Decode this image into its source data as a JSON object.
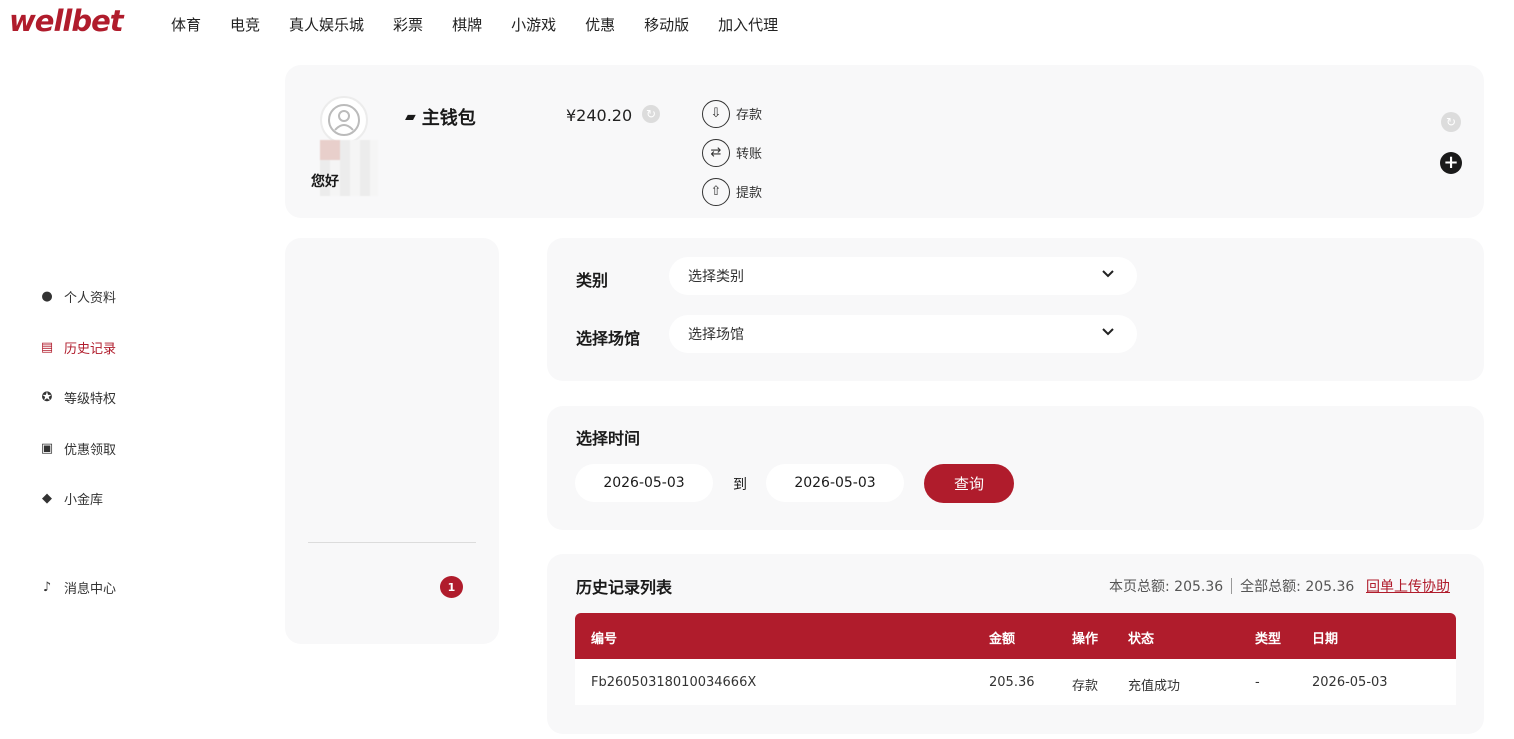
{
  "brand": {
    "logo_text": "wellbet",
    "color": "#b01c2c"
  },
  "nav": [
    "体育",
    "电竞",
    "真人娱乐城",
    "彩票",
    "棋牌",
    "小游戏",
    "优惠",
    "移动版",
    "加入代理"
  ],
  "profile": {
    "nickname": "您好",
    "wallet_title": "主钱包",
    "balance": "¥240.20",
    "actions": [
      {
        "label": "存款",
        "icon": "deposit-icon"
      },
      {
        "label": "转账",
        "icon": "transfer-icon"
      },
      {
        "label": "提款",
        "icon": "withdraw-icon"
      }
    ]
  },
  "sidebar": {
    "items": [
      {
        "label": "个人资料",
        "icon": "user-icon"
      },
      {
        "label": "历史记录",
        "icon": "history-icon",
        "active": true
      },
      {
        "label": "等级特权",
        "icon": "medal-icon"
      },
      {
        "label": "优惠领取",
        "icon": "gift-icon"
      },
      {
        "label": "小金库",
        "icon": "diamond-icon"
      }
    ],
    "messages": {
      "label": "消息中心",
      "icon": "bell-icon",
      "count": "1"
    }
  },
  "filters": {
    "category_label": "类别",
    "category_value": "选择类别",
    "venue_label": "选择场馆",
    "venue_value": "选择场馆"
  },
  "time": {
    "title": "选择时间",
    "start": "2026-05-03",
    "to": "到",
    "end": "2026-05-03",
    "query": "查询"
  },
  "list": {
    "title": "历史记录列表",
    "page_total": "本页总额: 205.36",
    "all_total": "全部总额: 205.36",
    "help": "回单上传协助",
    "columns": [
      "编号",
      "金额",
      "操作",
      "状态",
      "类型",
      "日期"
    ],
    "rows": [
      [
        "Fb26050318010034666X",
        "205.36",
        "存款",
        "充值成功",
        "-",
        "2026-05-03"
      ]
    ]
  }
}
